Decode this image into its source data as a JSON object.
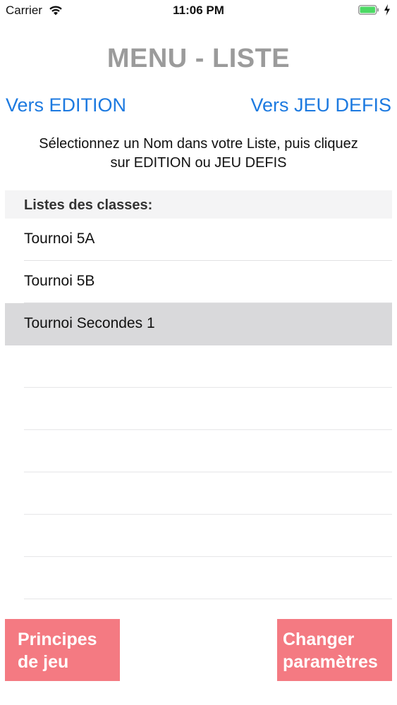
{
  "status_bar": {
    "carrier": "Carrier",
    "time": "11:06 PM",
    "battery_color": "#4cd964"
  },
  "title": "MENU - LISTE",
  "nav": {
    "left_label": "Vers EDITION",
    "right_label": "Vers JEU DEFIS",
    "link_color": "#1d7ae0"
  },
  "instructions": {
    "line1": "Sélectionnez un Nom dans votre Liste, puis cliquez",
    "line2": "sur EDITION ou JEU DEFIS"
  },
  "list": {
    "header": "Listes des classes:",
    "items": [
      {
        "label": "Tournoi 5A",
        "selected": false
      },
      {
        "label": "Tournoi 5B",
        "selected": false
      },
      {
        "label": "Tournoi Secondes 1",
        "selected": true
      }
    ]
  },
  "buttons": {
    "left": {
      "line1": "Principes",
      "line2": "de jeu"
    },
    "right": {
      "line1": "Changer",
      "line2": "paramètres"
    },
    "color": "#f47a82"
  }
}
